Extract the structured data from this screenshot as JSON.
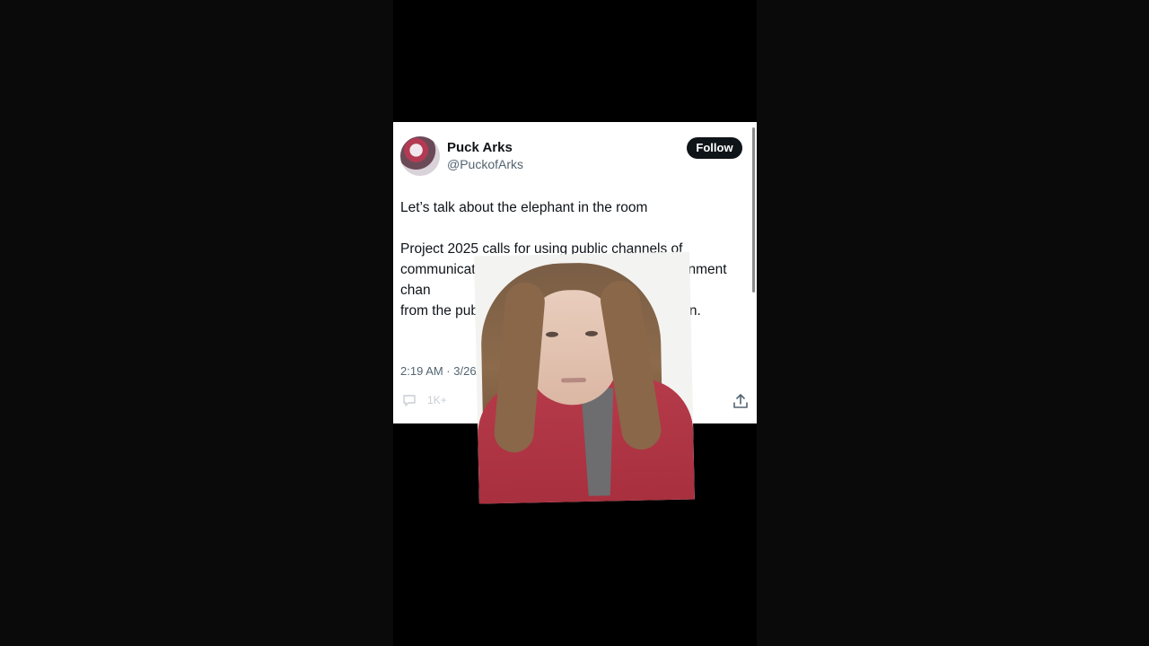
{
  "tweet": {
    "display_name": "Puck Arks",
    "handle": "@PuckofArks",
    "follow_label": "Follow",
    "paragraphs": [
      "Let’s talk about the elephant in the room",
      "Project 2025 calls for using public channels of communication (lik          stead of secure government chan            t FOIA requests and conceal dam             from the public. This was no roo              he plan."
    ],
    "timestamp": "2:19 AM · 3/26/2",
    "reply_count": "1K+"
  },
  "icons": {
    "reply": "reply-icon",
    "share": "share-icon",
    "avatar": "avatar"
  }
}
